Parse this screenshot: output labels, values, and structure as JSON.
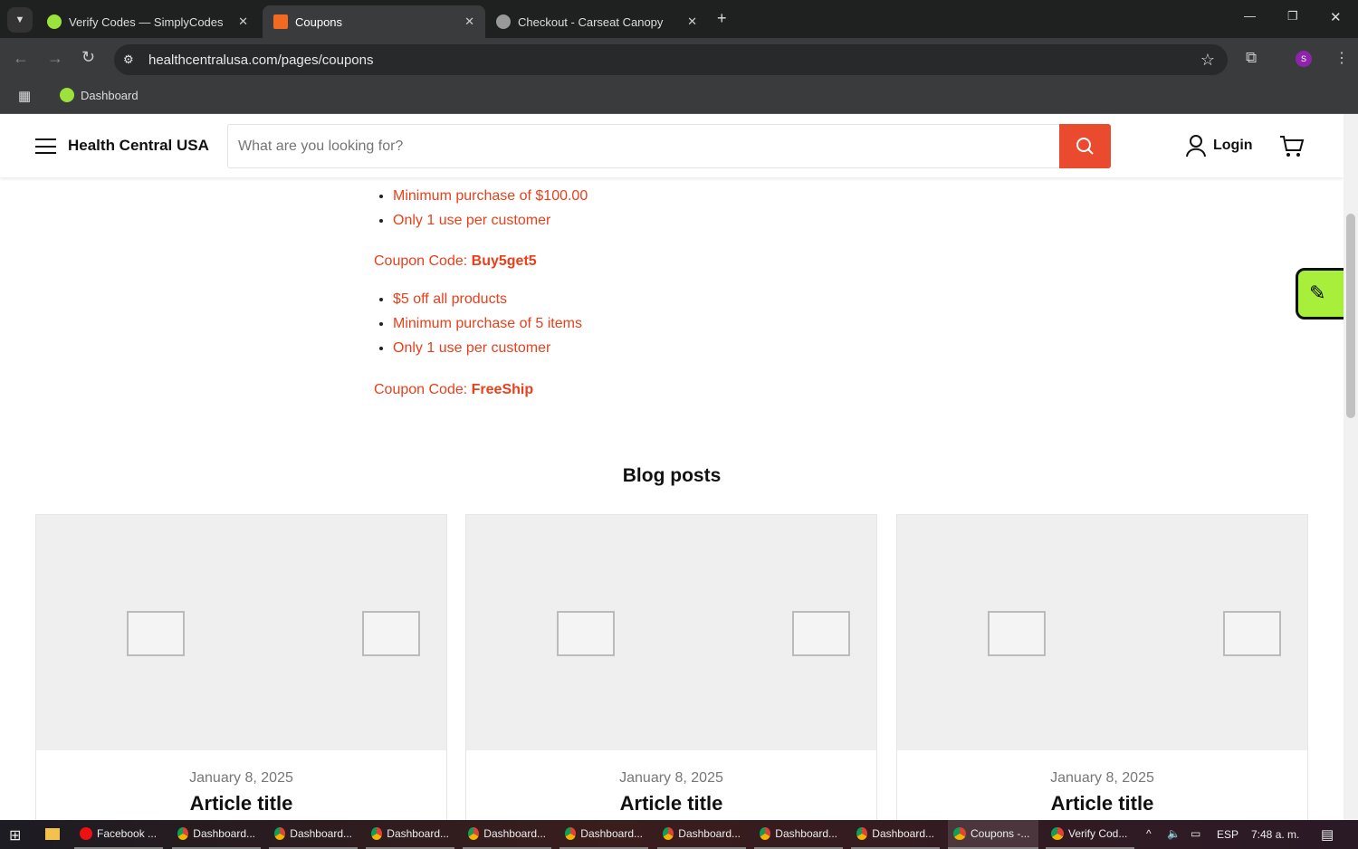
{
  "browser": {
    "tabs": [
      {
        "title": "Verify Codes — SimplyCodes"
      },
      {
        "title": "Coupons"
      },
      {
        "title": "Checkout - Carseat Canopy"
      }
    ],
    "url": "healthcentralusa.com/pages/coupons",
    "bookmarks": [
      {
        "label": "Dashboard"
      }
    ],
    "profile": "S"
  },
  "site": {
    "name": "Health Central USA",
    "search_placeholder": "What are you looking for?",
    "login": "Login"
  },
  "coupons": {
    "first_items": [
      "Minimum purchase of $100.00",
      "Only 1 use per customer"
    ],
    "blocks": [
      {
        "prefix": "Coupon Code: ",
        "code": "Buy5get5",
        "items": [
          "$5 off all products",
          "Minimum purchase of 5 items",
          "Only 1 use per customer"
        ]
      },
      {
        "prefix": "Coupon Code: ",
        "code": "FreeShip"
      }
    ]
  },
  "blog": {
    "heading": "Blog posts",
    "posts": [
      {
        "date": "January 8, 2025",
        "title": "Article title"
      },
      {
        "date": "January 8, 2025",
        "title": "Article title"
      },
      {
        "date": "January 8, 2025",
        "title": "Article title"
      }
    ]
  },
  "taskbar": {
    "items": [
      "Facebook ...",
      "Dashboard...",
      "Dashboard...",
      "Dashboard...",
      "Dashboard...",
      "Dashboard...",
      "Dashboard...",
      "Dashboard...",
      "Dashboard...",
      "Coupons -...",
      "Verify Cod..."
    ],
    "lang": "ESP",
    "time": "7:48 a. m."
  }
}
